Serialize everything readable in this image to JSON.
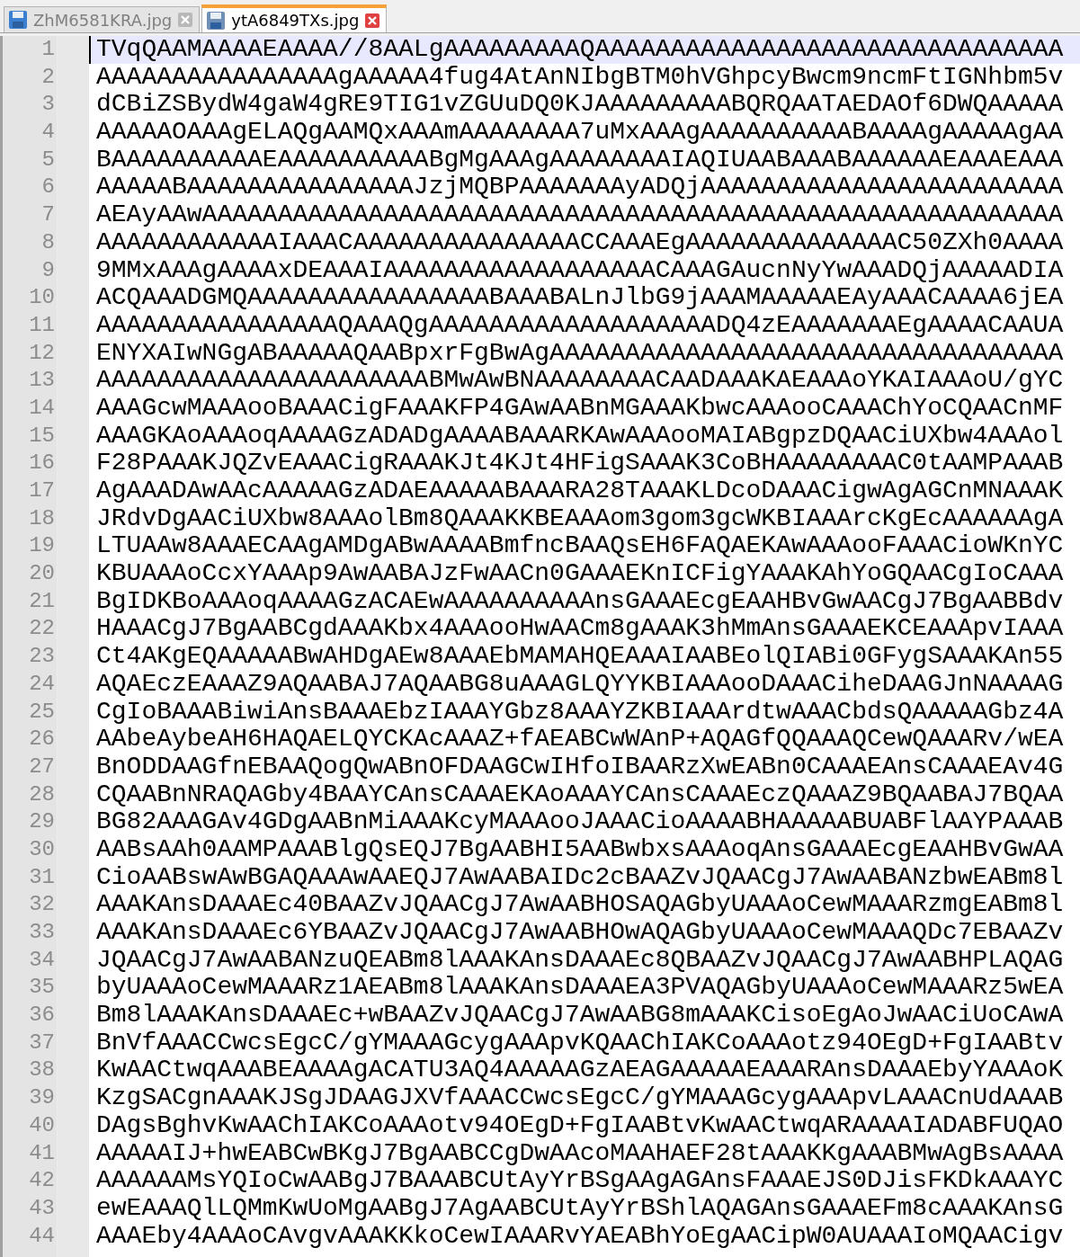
{
  "tabs": [
    {
      "label": "ZhM6581KRA.jpg",
      "selected": false
    },
    {
      "label": "ytA6849TXs.jpg",
      "selected": true
    }
  ],
  "lines": [
    {
      "number": "1",
      "text": "TVqQAAMAAAAEAAAA//8AALgAAAAAAAAAQAAAAAAAAAAAAAAAAAAAAAAAAAAAAAAA",
      "current": true
    },
    {
      "number": "2",
      "text": "AAAAAAAAAAAAAAAAgAAAAA4fug4AtAnNIbgBTM0hVGhpcyBwcm9ncmFtIGNhbm5v",
      "current": false
    },
    {
      "number": "3",
      "text": "dCBiZSBydW4gaW4gRE9TIG1vZGUuDQ0KJAAAAAAAAABQRQAATAEDAOf6DWQAAAAA",
      "current": false
    },
    {
      "number": "4",
      "text": "AAAAAOAAAgELAQgAAMQxAAAmAAAAAAAA7uMxAAAgAAAAAAAAAABAAAAgAAAAAgAA",
      "current": false
    },
    {
      "number": "5",
      "text": "BAAAAAAAAAAEAAAAAAAAAABgMgAAAgAAAAAAAAIAQIUAABAAABAAAAAAEAAAEAAA",
      "current": false
    },
    {
      "number": "6",
      "text": "AAAAABAAAAAAAAAAAAAAAJzjMQBPAAAAAAAyADQjAAAAAAAAAAAAAAAAAAAAAAAA",
      "current": false
    },
    {
      "number": "7",
      "text": "AEAyAAwAAAAAAAAAAAAAAAAAAAAAAAAAAAAAAAAAAAAAAAAAAAAAAAAAAAAAAAAA",
      "current": false
    },
    {
      "number": "8",
      "text": "AAAAAAAAAAAAIAAACAAAAAAAAAAAAAAACCAAAEgAAAAAAAAAAAAAAC50ZXh0AAAA",
      "current": false
    },
    {
      "number": "9",
      "text": "9MMxAAAgAAAAxDEAAAIAAAAAAAAAAAAAAAAAACAAAGAucnNyYwAAADQjAAAAADIA",
      "current": false
    },
    {
      "number": "10",
      "text": "ACQAAADGMQAAAAAAAAAAAAAAAABAAABALnJlbG9jAAAMAAAAAEAyAAACAAAA6jEA",
      "current": false
    },
    {
      "number": "11",
      "text": "AAAAAAAAAAAAAAAAQAAAQgAAAAAAAAAAAAAAAAAAADQ4zEAAAAAAAEgAAAACAAUA",
      "current": false
    },
    {
      "number": "12",
      "text": "ENYXAIwNGgABAAAAAQAABpxrFgBwAgAAAAAAAAAAAAAAAAAAAAAAAAAAAAAAAAAA",
      "current": false
    },
    {
      "number": "13",
      "text": "AAAAAAAAAAAAAAAAAAAAAABMwAwBNAAAAAAAACAADAAAKAEAAAoYKAIAAAoU/gYC",
      "current": false
    },
    {
      "number": "14",
      "text": "AAAGcwMAAAooBAAACigFAAAKFP4GAwAABnMGAAAKbwcAAAooCAAAChYoCQAACnMF",
      "current": false
    },
    {
      "number": "15",
      "text": "AAAGKAoAAAoqAAAAGzADADgAAAABAAARKAwAAAooMAIABgpzDQAACiUXbw4AAAol",
      "current": false
    },
    {
      "number": "16",
      "text": "F28PAAAKJQZvEAAACigRAAAKJt4KJt4HFigSAAAK3CoBHAAAAAAAAC0tAAMPAAAB",
      "current": false
    },
    {
      "number": "17",
      "text": "AgAAADAwAAcAAAAAGzADAEAAAAABAAARA28TAAAKLDcoDAAACigwAgAGCnMNAAAK",
      "current": false
    },
    {
      "number": "18",
      "text": "JRdvDgAACiUXbw8AAAolBm8QAAAKKBEAAAom3gom3gcWKBIAAArcKgEcAAAAAAgA",
      "current": false
    },
    {
      "number": "19",
      "text": "LTUAAw8AAAECAAgAMDgABwAAAABmfncBAAQsEH6FAQAEKAwAAAooFAAACioWKnYC",
      "current": false
    },
    {
      "number": "20",
      "text": "KBUAAAoCcxYAAAp9AwAABAJzFwAACn0GAAAEKnICFigYAAAKAhYoGQAACgIoCAAA",
      "current": false
    },
    {
      "number": "21",
      "text": "BgIDKBoAAAoqAAAAGzACAEwAAAAAAAAAAnsGAAAEcgEAAHBvGwAACgJ7BgAABBdv",
      "current": false
    },
    {
      "number": "22",
      "text": "HAAACgJ7BgAABCgdAAAKbx4AAAooHwAACm8gAAAK3hMmAnsGAAAEKCEAAApvIAAA",
      "current": false
    },
    {
      "number": "23",
      "text": "Ct4AKgEQAAAAABwAHDgAEw8AAAEbMAMAHQEAAAIAABEolQIABi0GFygSAAAKAn55",
      "current": false
    },
    {
      "number": "24",
      "text": "AQAEczEAAAZ9AQAABAJ7AQAABG8uAAAGLQYYKBIAAAooDAAACiheDAAGJnNAAAAG",
      "current": false
    },
    {
      "number": "25",
      "text": "CgIoBAAABiwiAnsBAAAEbzIAAAYGbz8AAAYZKBIAAArdtwAAACbdsQAAAAAGbz4A",
      "current": false
    },
    {
      "number": "26",
      "text": "AAbeAybeAH6HAQAELQYCKAcAAAZ+fAEABCwWAnP+AQAGfQQAAAQCewQAAARv/wEA",
      "current": false
    },
    {
      "number": "27",
      "text": "BnODDAAGfnEBAAQogQwABnOFDAAGCwIHfoIBAARzXwEABn0CAAAEAnsCAAAEAv4G",
      "current": false
    },
    {
      "number": "28",
      "text": "CQAABnNRAQAGby4BAAYCAnsCAAAEKAoAAAYCAnsCAAAEczQAAAZ9BQAABAJ7BQAA",
      "current": false
    },
    {
      "number": "29",
      "text": "BG82AAAGAv4GDgAABnMiAAAKcyMAAAooJAAACioAAAABHAAAAABUABFlAAYPAAAB",
      "current": false
    },
    {
      "number": "30",
      "text": "AABsAAh0AAMPAAABlgQsEQJ7BgAABHI5AABwbxsAAAoqAnsGAAAEcgEAAHBvGwAA",
      "current": false
    },
    {
      "number": "31",
      "text": "CioAABswAwBGAQAAAwAAEQJ7AwAABAIDc2cBAAZvJQAACgJ7AwAABANzbwEABm8l",
      "current": false
    },
    {
      "number": "32",
      "text": "AAAKAnsDAAAEc40BAAZvJQAACgJ7AwAABHOSAQAGbyUAAAoCewMAAARzmgEABm8l",
      "current": false
    },
    {
      "number": "33",
      "text": "AAAKAnsDAAAEc6YBAAZvJQAACgJ7AwAABHOwAQAGbyUAAAoCewMAAAQDc7EBAAZv",
      "current": false
    },
    {
      "number": "34",
      "text": "JQAACgJ7AwAABANzuQEABm8lAAAKAnsDAAAEc8QBAAZvJQAACgJ7AwAABHPLAQAG",
      "current": false
    },
    {
      "number": "35",
      "text": "byUAAAoCewMAAARz1AEABm8lAAAKAnsDAAAEA3PVAQAGbyUAAAoCewMAAARz5wEA",
      "current": false
    },
    {
      "number": "36",
      "text": "Bm8lAAAKAnsDAAAEc+wBAAZvJQAACgJ7AwAABG8mAAAKCisoEgAoJwAACiUoCAwA",
      "current": false
    },
    {
      "number": "37",
      "text": "BnVfAAACCwcsEgcC/gYMAAAGcygAAApvKQAAChIAKCoAAAotz94OEgD+FgIAABtv",
      "current": false
    },
    {
      "number": "38",
      "text": "KwAACtwqAAABEAAAAgACATU3AQ4AAAAAGzAEAGAAAAAEAAARAnsDAAAEbyYAAAoK",
      "current": false
    },
    {
      "number": "39",
      "text": "KzgSACgnAAAKJSgJDAAGJXVfAAACCwcsEgcC/gYMAAAGcygAAApvLAAACnUdAAAB",
      "current": false
    },
    {
      "number": "40",
      "text": "DAgsBghvKwAAChIAKCoAAAotv94OEgD+FgIAABtvKwAACtwqARAAAAIADABFUQAO",
      "current": false
    },
    {
      "number": "41",
      "text": "AAAAAIJ+hwEABCwBKgJ7BgAABCCgDwAAcoMAAHAEF28tAAAKKgAAABMwAgBsAAAA",
      "current": false
    },
    {
      "number": "42",
      "text": "AAAAAAMsYQIoCwAABgJ7BAAABCUtAyYrBSgAAgAGAnsFAAAEJS0DJisFKDkAAAYC",
      "current": false
    },
    {
      "number": "43",
      "text": "ewEAAAQlLQMmKwUoMgAABgJ7AgAABCUtAyYrBShlAQAGAnsGAAAEFm8cAAAKAnsG",
      "current": false
    },
    {
      "number": "44",
      "text": "AAAEby4AAAoCAvgvAAAKKkoCewIAAARvYAEABhYoEgAACipW0AUAAAIoMQAACigv",
      "current": false
    }
  ]
}
